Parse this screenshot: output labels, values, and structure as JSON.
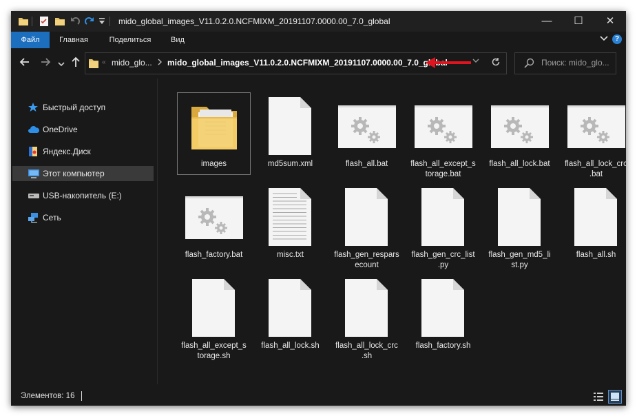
{
  "window": {
    "title": "mido_global_images_V11.0.2.0.NCFMIXM_20191107.0000.00_7.0_global",
    "controls": {
      "minimize": "—",
      "maximize": "☐",
      "close": "✕"
    }
  },
  "ribbon": {
    "tabs": [
      "Файл",
      "Главная",
      "Поделиться",
      "Вид"
    ],
    "help": "?"
  },
  "address": {
    "crumbs": [
      "mido_glo...",
      "mido_global_images_V11.0.2.0.NCFMIXM_20191107.0000.00_7.0_global"
    ],
    "overflow": "«"
  },
  "search": {
    "placeholder": "Поиск: mido_glo..."
  },
  "sidebar": {
    "items": [
      {
        "label": "Быстрый доступ",
        "icon": "star-icon"
      },
      {
        "label": "OneDrive",
        "icon": "cloud-icon"
      },
      {
        "label": "Яндекс.Диск",
        "icon": "yandex-disk-icon"
      },
      {
        "label": "Этот компьютер",
        "icon": "computer-icon",
        "selected": true
      },
      {
        "label": "USB-накопитель (E:)",
        "icon": "usb-drive-icon"
      },
      {
        "label": "Сеть",
        "icon": "network-icon"
      }
    ]
  },
  "files": [
    {
      "name": "images",
      "type": "folder",
      "selected": true
    },
    {
      "name": "md5sum.xml",
      "type": "doc"
    },
    {
      "name": "flash_all.bat",
      "type": "bat"
    },
    {
      "name": "flash_all_except_s\ntorage.bat",
      "type": "bat"
    },
    {
      "name": "flash_all_lock.bat",
      "type": "bat"
    },
    {
      "name": "flash_all_lock_crc\n.bat",
      "type": "bat"
    },
    {
      "name": "flash_factory.bat",
      "type": "bat"
    },
    {
      "name": "misc.txt",
      "type": "txt"
    },
    {
      "name": "flash_gen_respars\necount",
      "type": "doc"
    },
    {
      "name": "flash_gen_crc_list\n.py",
      "type": "doc"
    },
    {
      "name": "flash_gen_md5_li\nst.py",
      "type": "doc"
    },
    {
      "name": "flash_all.sh",
      "type": "doc"
    },
    {
      "name": "flash_all_except_s\ntorage.sh",
      "type": "doc"
    },
    {
      "name": "flash_all_lock.sh",
      "type": "doc"
    },
    {
      "name": "flash_all_lock_crc\n.sh",
      "type": "doc"
    },
    {
      "name": "flash_factory.sh",
      "type": "doc"
    }
  ],
  "status": {
    "text": "Элементов: 16"
  },
  "colors": {
    "accent": "#1c6fbf",
    "arrow": "#e0141e",
    "background": "#191919"
  }
}
